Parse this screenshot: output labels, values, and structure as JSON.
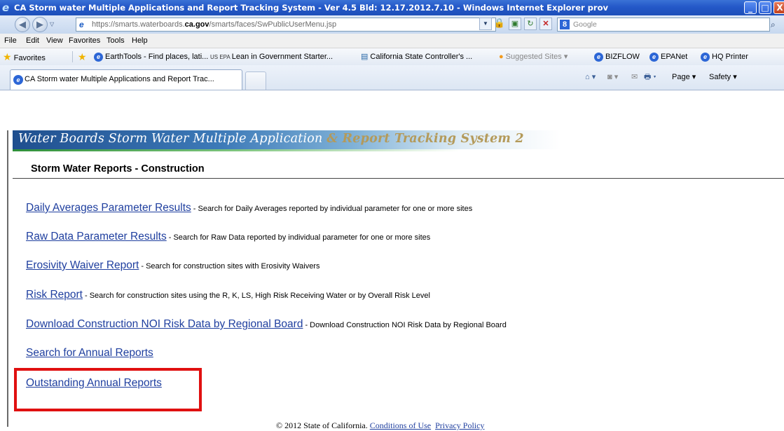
{
  "window": {
    "title": "CA Storm water Multiple Applications and Report Tracking System - Ver 4.5 Bld: 12.17.2012.7.10 - Windows Internet Explorer prov",
    "ie_logo": "e",
    "min_glyph": "_",
    "max_glyph": "□",
    "close_glyph": "X"
  },
  "addressbar": {
    "back_glyph": "◀",
    "forward_glyph": "▶",
    "dropdown_glyph": "▽",
    "page_icon": "e",
    "url_prefix": "https://smarts.waterboards.",
    "url_domain": "ca.gov",
    "url_path": "/smarts/faces/SwPublicUserMenu.jsp",
    "dropdown_btn": "▼",
    "lock_glyph": "🔒",
    "compat_glyph": "▣",
    "refresh_glyph": "↻",
    "stop_glyph": "✕",
    "search_logo": "8",
    "search_placeholder": "Google",
    "search_glyph": "⌕"
  },
  "menubar": {
    "items": [
      "File",
      "Edit",
      "View",
      "Favorites",
      "Tools",
      "Help"
    ]
  },
  "favorites": {
    "label": "Favorites",
    "star_glyph": "★",
    "add_glyph": "★",
    "ie_glyph": "e",
    "epa_glyph": "US EPA",
    "sco_glyph": "▤",
    "suggested_glyph": "●",
    "items": [
      "EarthTools - Find places, lati...",
      "Lean in Government Starter...",
      "California State Controller's ...",
      "Suggested Sites ▾",
      "BIZFLOW",
      "EPANet",
      "HQ Printer"
    ]
  },
  "tabs": {
    "active_label": "CA Storm water Multiple Applications and Report Trac...",
    "tab_icon": "e"
  },
  "commandbar": {
    "home_glyph": "⌂ ▾",
    "feeds_glyph": "◙ ▾",
    "mail_glyph": "✉",
    "print_glyph": "🖶 ▾",
    "page_label": "Page ▾",
    "safety_label": "Safety ▾"
  },
  "banner": {
    "text_main": "Water Boards  Storm Water Multiple Application ",
    "text_accent": "& Report Tracking System 2"
  },
  "section_title": "Storm Water Reports - Construction",
  "reports": [
    {
      "link": "Daily Averages Parameter Results",
      "desc": "- Search for Daily Averages reported by individual parameter for one or more sites"
    },
    {
      "link": "Raw Data Parameter Results",
      "desc": "- Search for Raw Data reported by individual parameter for one or more sites"
    },
    {
      "link": "Erosivity Waiver Report",
      "desc": "- Search for construction sites with Erosivity Waivers"
    },
    {
      "link": "Risk Report",
      "desc": "- Search for construction sites using the R, K, LS, High Risk Receiving Water or by Overall Risk Level"
    },
    {
      "link": "Download Construction NOI Risk Data by Regional Board",
      "desc": "- Download Construction NOI Risk Data by Regional Board"
    },
    {
      "link": "Search for Annual Reports",
      "desc": ""
    },
    {
      "link": "Outstanding Annual Reports",
      "desc": ""
    }
  ],
  "footer": {
    "copyright": "© 2012 State of California.",
    "conditions": "Conditions of Use",
    "privacy": "Privacy Policy"
  }
}
